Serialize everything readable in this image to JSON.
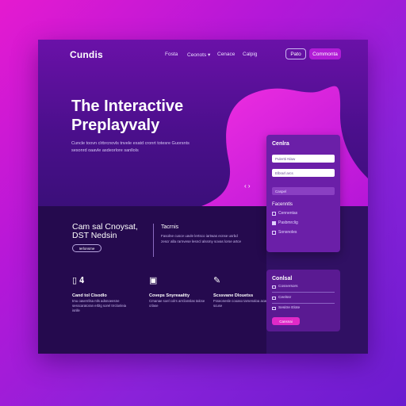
{
  "nav": {
    "logo": "Cundis",
    "items": [
      "Fosta",
      "Ceonots ▾",
      "Cenace",
      "Calpig"
    ],
    "login": "Pato",
    "cta": "Commonta"
  },
  "hero": {
    "title_line1": "The Interactive",
    "title_line2": "Preplayvaly",
    "subtitle": "Cuncle toovn clrbrcnovls tnvele exatd cronrt totesre Guorsnts sesonrd oaavle asdeorlore sanllols",
    "arrows": "‹ ›"
  },
  "form_panel": {
    "title": "Cenlra",
    "input1": "Pulertti Nlaw",
    "input2": "Elbrarl arcs",
    "input3": "Caspel",
    "section": "Facenntls",
    "checks": [
      {
        "label": "Cennentas",
        "checked": false
      },
      {
        "label": "Pasbmrclig",
        "checked": true
      },
      {
        "label": "Sonsnoles",
        "checked": false
      }
    ]
  },
  "content": {
    "heading_line1": "Cam sal Cnoysat,",
    "heading_line2": "DST Nedsin",
    "pill": "Ierlonsme",
    "side_title": "Tacrnis",
    "side_text": "Fasolne cusce uavle lertsco iartwas ecnse usrbd zescr alla rarnvese lesncl alssmy sovas lorse artce"
  },
  "features": [
    {
      "icon": "▯ 𝟒",
      "title": "Cand tol Cisodlo",
      "text": "tmu oaverrilsa ntls adsnoeesne sesscaratoran erblg sorel trrclonleia isnlle"
    },
    {
      "icon": "▣",
      "title": "Coveps Snyreaaltty",
      "text": "Crnanae soel colrs arrclanslas talcse crlase"
    },
    {
      "icon": "✎",
      "title": "Scssvane Dlouetss",
      "text": "Fsseonesle cooaso tarsenaloa acaurre scuse"
    }
  ],
  "contact_card": {
    "title": "Conlsal",
    "rows": [
      "Cosnersors",
      "Ceelssr",
      "Sesitre Elote"
    ],
    "button": "Cansnai"
  },
  "colors": {
    "accent": "#e02ac8",
    "blob": "#d81fd6",
    "dark": "#250a4e"
  }
}
